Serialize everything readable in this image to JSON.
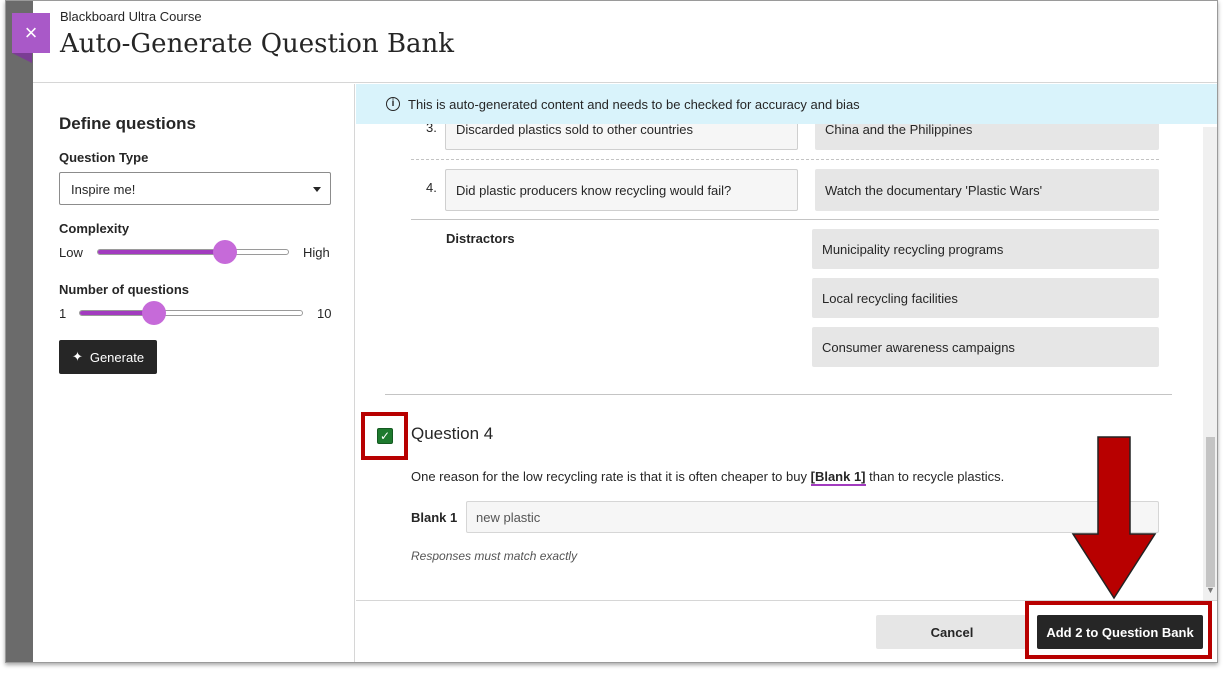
{
  "header": {
    "course_name": "Blackboard Ultra Course",
    "title": "Auto-Generate Question Bank",
    "close_glyph": "×"
  },
  "sidebar": {
    "title": "Define questions",
    "question_type_label": "Question Type",
    "question_type_value": "Inspire me!",
    "complexity": {
      "label": "Complexity",
      "min_label": "Low",
      "max_label": "High",
      "level_fraction": 0.75
    },
    "number_of_questions": {
      "label": "Number of questions",
      "min_label": "1",
      "max_label": "10",
      "value": 4
    },
    "generate_label": "Generate"
  },
  "notice": {
    "icon": "info-icon",
    "text": "This is auto-generated content and needs to be checked for accuracy and bias"
  },
  "matching": {
    "rows": [
      {
        "number": "3.",
        "prompt": "Discarded plastics sold to other countries",
        "answer": "China and the Philippines"
      },
      {
        "number": "4.",
        "prompt": "Did plastic producers know recycling would fail?",
        "answer": "Watch the documentary 'Plastic Wars'"
      }
    ],
    "distractors_label": "Distractors",
    "distractors": [
      "Municipality recycling programs",
      "Local recycling facilities",
      "Consumer awareness campaigns"
    ]
  },
  "question4": {
    "checked_glyph": "✓",
    "title": "Question 4",
    "text_before": "One reason for the low recycling rate is that it is often cheaper to buy ",
    "blank_ref": "[Blank 1]",
    "text_after": " than to recycle plastics.",
    "blank_label": "Blank 1",
    "blank_value": "new plastic",
    "note": "Responses must match exactly"
  },
  "footer": {
    "cancel_label": "Cancel",
    "add_label": "Add 2 to Question Bank"
  },
  "colors": {
    "accent_purple": "#a959c8",
    "slider_fill": "#a23bbf",
    "notice_bg": "#d9f3fb",
    "annotation_red": "#b80000",
    "checkbox_green": "#1e7a2e"
  }
}
